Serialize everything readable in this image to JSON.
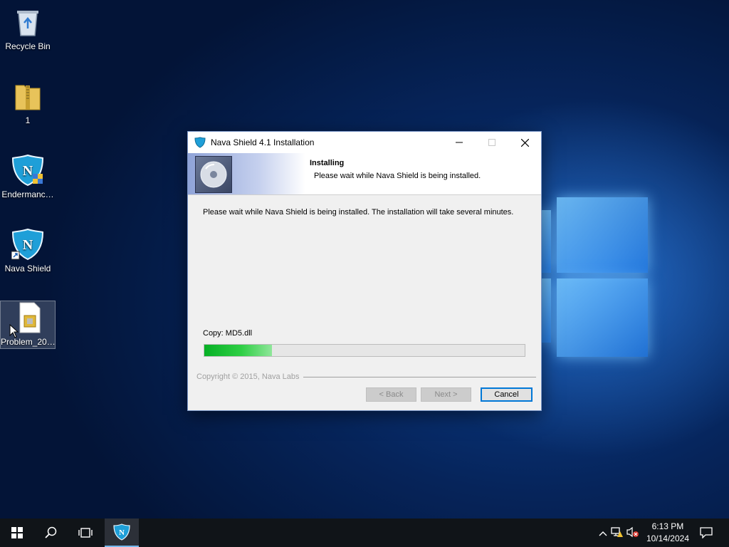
{
  "desktop": {
    "icons": [
      {
        "label": "Recycle Bin"
      },
      {
        "label": "1"
      },
      {
        "label": "Endermanc…"
      },
      {
        "label": "Nava Shield"
      },
      {
        "label": "Problem_20…"
      }
    ]
  },
  "dialog": {
    "title": "Nava Shield 4.1 Installation",
    "header_title": "Installing",
    "header_subtitle": "Please wait while Nava Shield is being installed.",
    "body_text": "Please wait while Nava Shield is being installed. The installation will take several minutes.",
    "status_text": "Copy: MD5.dll",
    "progress": 0.21,
    "copyright": "Copyright © 2015, Nava Labs",
    "buttons": {
      "back": "< Back",
      "next": "Next >",
      "cancel": "Cancel"
    }
  },
  "taskbar": {
    "time": "6:13 PM",
    "date": "10/14/2024"
  },
  "colors": {
    "accent": "#0078d7",
    "progress": "#06b025"
  }
}
